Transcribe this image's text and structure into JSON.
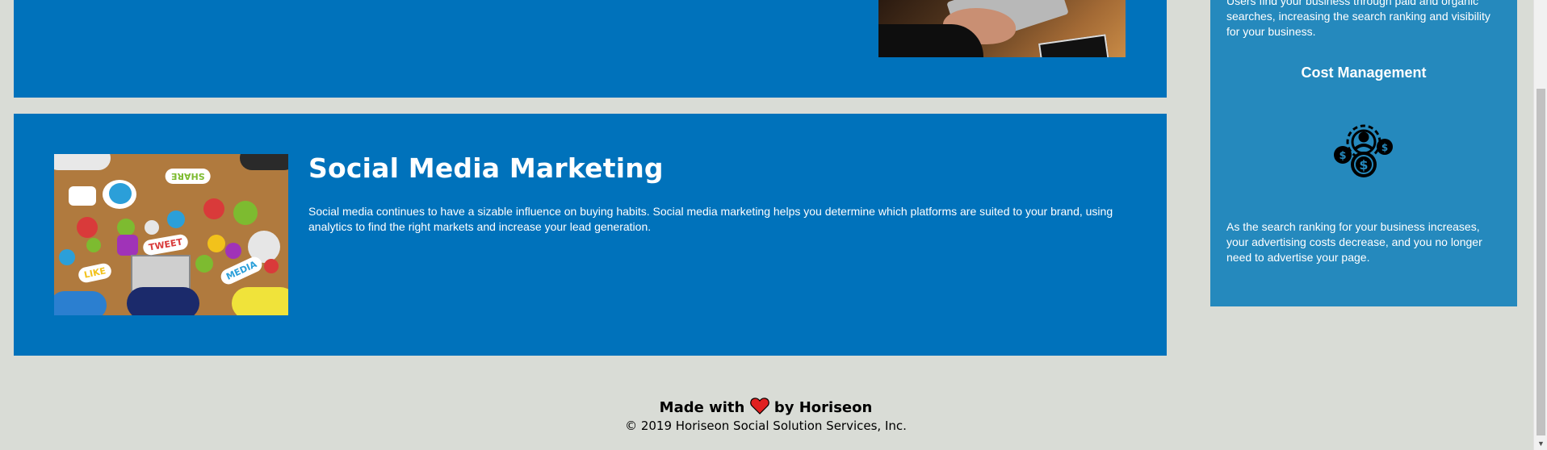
{
  "social_section": {
    "title": "Social Media Marketing",
    "text": "Social media continues to have a sizable influence on buying habits. Social media marketing helps you determine which platforms are suited to your brand, using analytics to find the right markets and increase your lead generation.",
    "image_icon": "social-media-photo",
    "image_tags": [
      "SHARE",
      "TWEET",
      "LIKE",
      "MEDIA"
    ]
  },
  "sidebar": {
    "top_text": "Users find your business through paid and organic searches, increasing the search ranking and visibility for your business.",
    "heading": "Cost Management",
    "icon": "cost-management-icon",
    "bottom_text": "As the search ranking for your business increases, your advertising costs decrease, and you no longer need to advertise your page."
  },
  "footer": {
    "made_prefix": "Made with",
    "made_suffix": "by Horiseon",
    "heart_icon": "heart-icon",
    "copyright": "© 2019 Horiseon Social Solution Services, Inc."
  },
  "colors": {
    "section_blue": "#0072bb",
    "sidebar_blue": "#2589bd",
    "page_background": "#d9dcd6",
    "heart_red": "#e02020"
  }
}
